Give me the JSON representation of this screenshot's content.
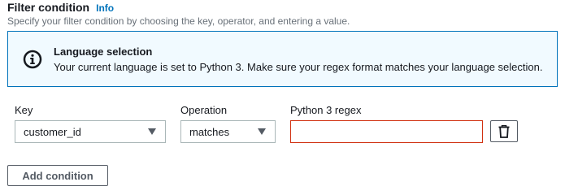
{
  "header": {
    "title": "Filter condition",
    "info_link": "Info",
    "description": "Specify your filter condition by choosing the key, operator, and entering a value."
  },
  "alert": {
    "icon": "info-circle-icon",
    "heading": "Language selection",
    "text": "Your current language is set to Python 3. Make sure your regex format matches your language selection.",
    "border_color": "#0073bb",
    "background_color": "#f1faff"
  },
  "condition": {
    "key": {
      "label": "Key",
      "value": "customer_id",
      "icon": "caret-down-icon"
    },
    "operation": {
      "label": "Operation",
      "value": "matches",
      "icon": "caret-down-icon"
    },
    "regex": {
      "label": "Python 3 regex",
      "value": "",
      "border_color": "#d13212"
    },
    "delete_icon": "trash-icon"
  },
  "add_condition_label": "Add condition"
}
